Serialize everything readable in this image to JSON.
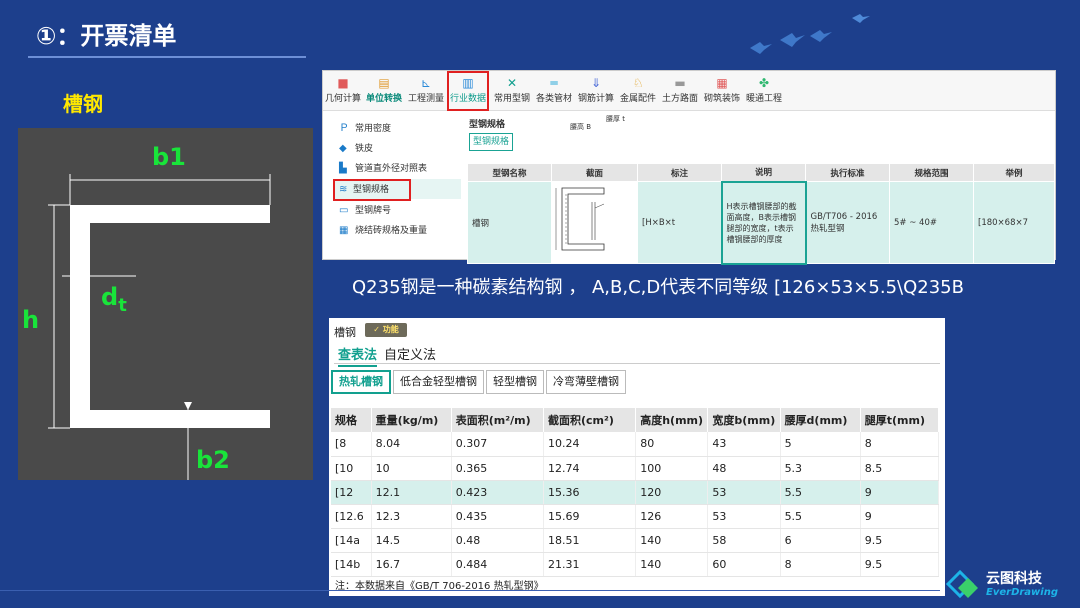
{
  "slide": {
    "title": "①：开票清单",
    "section": "槽钢",
    "note_line": "Q235钢是一种碳素结构钢 ， A,B,C,D代表不同等级 [126×53×5.5\\Q235B"
  },
  "diagram": {
    "b1": "b1",
    "h": "h",
    "dt_main": "d",
    "dt_sub": "t",
    "b2": "b2"
  },
  "top_app": {
    "toolbar": [
      {
        "label": "几何计算",
        "icon": "cube-icon"
      },
      {
        "label": "单位转换",
        "icon": "unit-icon"
      },
      {
        "label": "工程测量",
        "icon": "measure-icon"
      },
      {
        "label": "行业数据",
        "icon": "chart-icon"
      },
      {
        "label": "常用型钢",
        "icon": "tools-icon"
      },
      {
        "label": "各类管材",
        "icon": "pipe-icon"
      },
      {
        "label": "钢筋计算",
        "icon": "rebar-icon"
      },
      {
        "label": "金属配件",
        "icon": "fitting-icon"
      },
      {
        "label": "土方路面",
        "icon": "road-icon"
      },
      {
        "label": "砌筑装饰",
        "icon": "brick-icon"
      },
      {
        "label": "暖通工程",
        "icon": "hvac-icon"
      }
    ],
    "sidebar": [
      {
        "label": "常用密度",
        "icon": "density-icon"
      },
      {
        "label": "铁皮",
        "icon": "sheet-icon"
      },
      {
        "label": "管道直外径对照表",
        "icon": "pipe-table-icon"
      },
      {
        "label": "型钢规格",
        "icon": "layers-icon"
      },
      {
        "label": "型钢牌号",
        "icon": "grade-icon"
      },
      {
        "label": "烧结砖规格及重量",
        "icon": "brick-grid-icon"
      }
    ],
    "content_title": "型钢规格",
    "content_button": "型钢规格",
    "table": {
      "headers": [
        "型钢名称",
        "截面",
        "标注",
        "说明",
        "执行标准",
        "规格范围",
        "举例"
      ],
      "row": {
        "name": "槽钢",
        "section_labels": {
          "waist": "腰厚 t",
          "height": "腰高 B"
        },
        "mark": "[H×B×t",
        "desc": "H表示槽钢腰部的截面高度，B表示槽钢腿部的宽度，t表示槽钢腰部的厚度",
        "standard": "GB/T706 - 2016热轧型钢",
        "range": "5# ~ 40#",
        "example": "[180×68×7"
      }
    }
  },
  "bottom_app": {
    "heading": "槽钢",
    "func_badge": "功能",
    "mode_active": "查表法",
    "mode_other": "自定义法",
    "tabs": [
      "热轧槽钢",
      "低合金轻型槽钢",
      "轻型槽钢",
      "冷弯薄壁槽钢"
    ],
    "headers": [
      "规格",
      "重量(kg/m)",
      "表面积(m²/m)",
      "截面积(cm²)",
      "高度h(mm)",
      "宽度b(mm)",
      "腰厚d(mm)",
      "腿厚t(mm)"
    ],
    "rows": [
      [
        "[8",
        "8.04",
        "0.307",
        "10.24",
        "80",
        "43",
        "5",
        "8"
      ],
      [
        "[10",
        "10",
        "0.365",
        "12.74",
        "100",
        "48",
        "5.3",
        "8.5"
      ],
      [
        "[12",
        "12.1",
        "0.423",
        "15.36",
        "120",
        "53",
        "5.5",
        "9"
      ],
      [
        "[12.6",
        "12.3",
        "0.435",
        "15.69",
        "126",
        "53",
        "5.5",
        "9"
      ],
      [
        "[14a",
        "14.5",
        "0.48",
        "18.51",
        "140",
        "58",
        "6",
        "9.5"
      ],
      [
        "[14b",
        "16.7",
        "0.484",
        "21.31",
        "140",
        "60",
        "8",
        "9.5"
      ]
    ],
    "highlight_row": 2,
    "note": "注：本数据来自《GB/T 706-2016 热轧型钢》"
  },
  "logo": {
    "cn": "云图科技",
    "en": "EverDrawing"
  },
  "colors": {
    "bg": "#1d3f8c",
    "accent": "#12a08f",
    "yellow": "#ffe800",
    "dim_green": "#19e43a",
    "highlight": "#e02020"
  }
}
